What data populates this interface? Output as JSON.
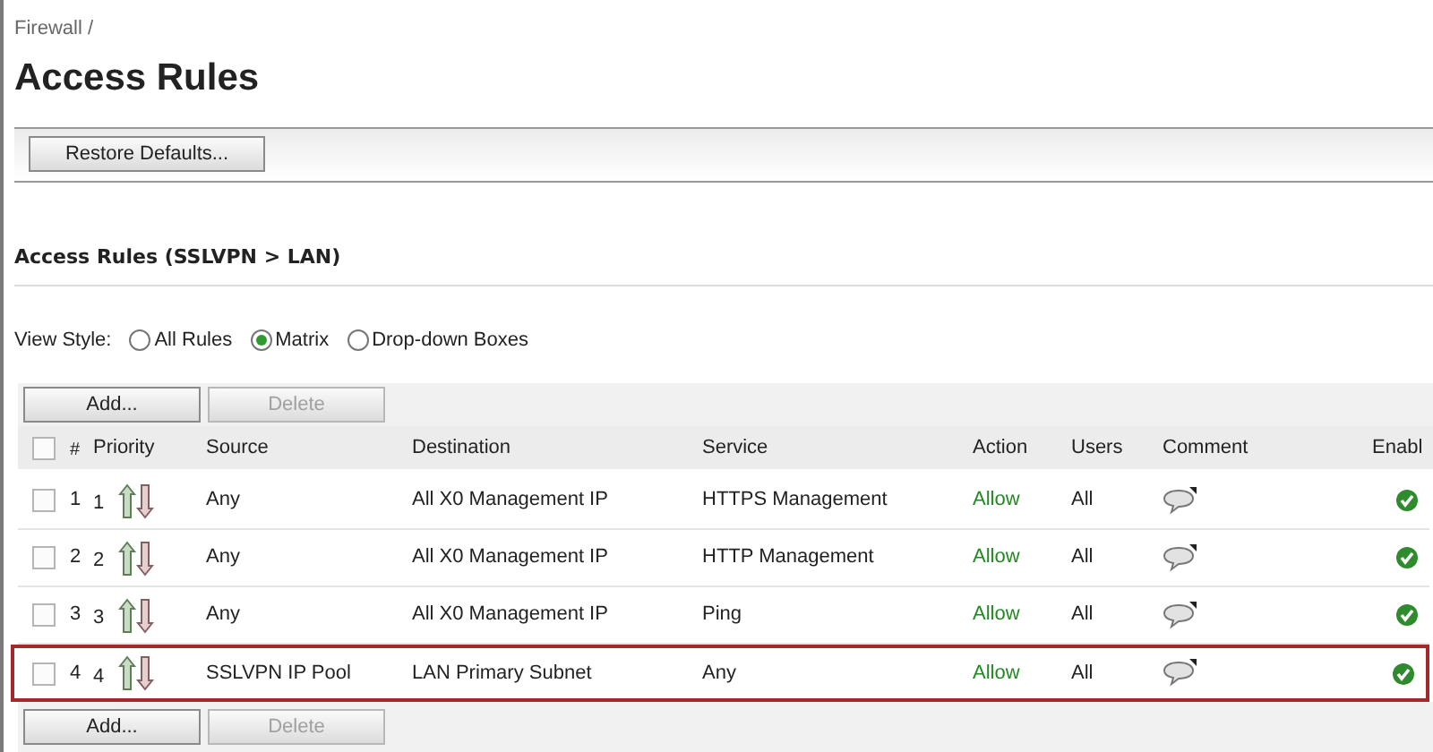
{
  "breadcrumb": "Firewall /",
  "title": "Access Rules",
  "toolbar": {
    "buttons": [
      {
        "label": "Restore Defaults...",
        "disabled": false
      }
    ]
  },
  "section_title": "Access Rules (SSLVPN > LAN)",
  "view_style": {
    "label": "View Style:",
    "options": [
      {
        "label": "All Rules",
        "selected": false
      },
      {
        "label": "Matrix",
        "selected": true
      },
      {
        "label": "Drop-down Boxes",
        "selected": false
      }
    ]
  },
  "top_buttons": [
    {
      "label": "Add...",
      "disabled": false
    },
    {
      "label": "Delete",
      "disabled": true
    }
  ],
  "table": {
    "header_checked": false,
    "columns": [
      "#",
      "Priority",
      "Source",
      "Destination",
      "Service",
      "Action",
      "Users",
      "Comment",
      "Enabl"
    ],
    "rows": [
      {
        "checked": false,
        "highlighted": false,
        "number": "1",
        "priority": "1",
        "source": "Any",
        "destination": "All X0 Management IP",
        "service": "HTTPS Management",
        "action": "Allow",
        "users": "All",
        "enabled": true
      },
      {
        "checked": false,
        "highlighted": false,
        "number": "2",
        "priority": "2",
        "source": "Any",
        "destination": "All X0 Management IP",
        "service": "HTTP Management",
        "action": "Allow",
        "users": "All",
        "enabled": true
      },
      {
        "checked": false,
        "highlighted": false,
        "number": "3",
        "priority": "3",
        "source": "Any",
        "destination": "All X0 Management IP",
        "service": "Ping",
        "action": "Allow",
        "users": "All",
        "enabled": true
      },
      {
        "checked": false,
        "highlighted": true,
        "number": "4",
        "priority": "4",
        "source": "SSLVPN IP Pool",
        "destination": "LAN Primary Subnet",
        "service": "Any",
        "action": "Allow",
        "users": "All",
        "enabled": true
      }
    ]
  },
  "bottom_buttons": [
    {
      "label": "Add...",
      "disabled": false
    },
    {
      "label": "Delete",
      "disabled": true
    }
  ]
}
